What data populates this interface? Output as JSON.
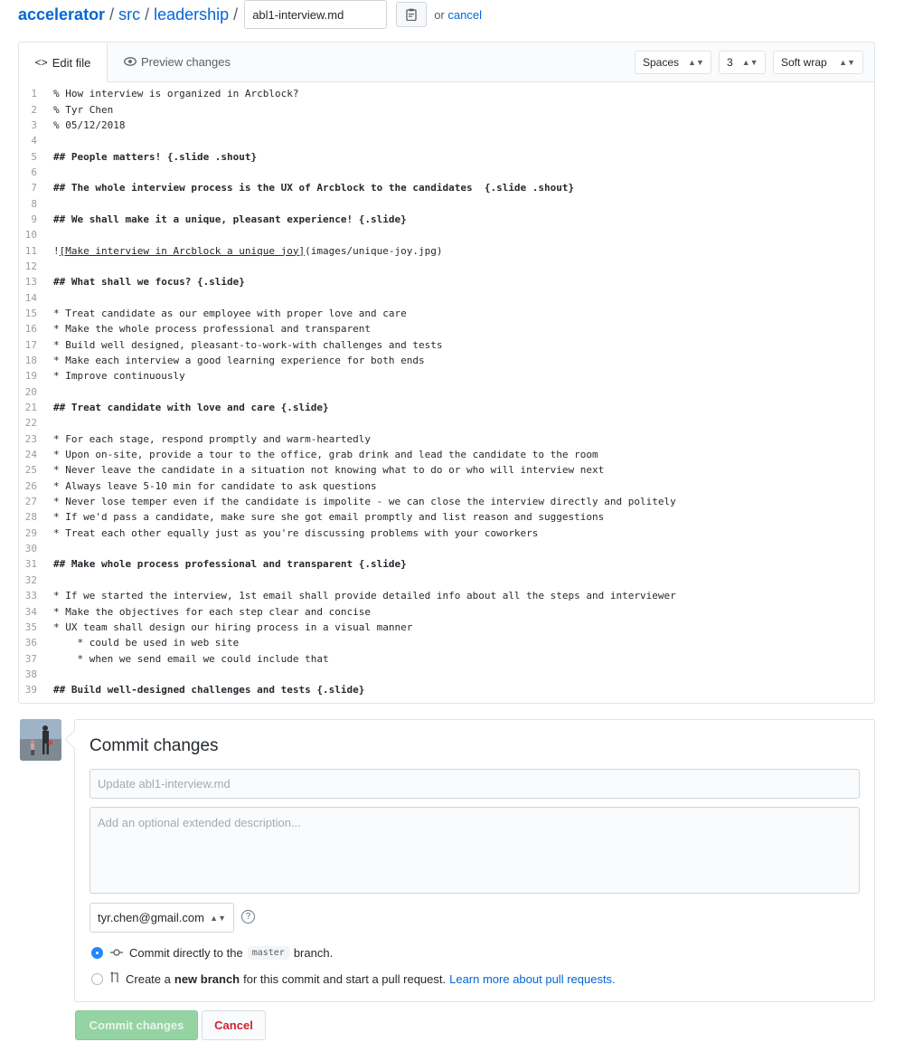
{
  "breadcrumb": {
    "repo": "accelerator",
    "path": [
      "src",
      "leadership"
    ],
    "separator": "/",
    "filename": "abl1-interview.md",
    "or_text": "or",
    "cancel_link": "cancel"
  },
  "editor": {
    "tabs": [
      {
        "label": "Edit file",
        "icon": "code-icon",
        "active": true
      },
      {
        "label": "Preview changes",
        "icon": "eye-icon",
        "active": false
      }
    ],
    "indent_mode": "Spaces",
    "indent_size": "3",
    "wrap_mode": "Soft wrap",
    "lines": [
      {
        "n": "1",
        "text": "% How interview is organized in Arcblock?",
        "heading": false
      },
      {
        "n": "2",
        "text": "% Tyr Chen",
        "heading": false
      },
      {
        "n": "3",
        "text": "% 05/12/2018",
        "heading": false
      },
      {
        "n": "4",
        "text": "",
        "heading": false
      },
      {
        "n": "5",
        "text": "## People matters! {.slide .shout}",
        "heading": true
      },
      {
        "n": "6",
        "text": "",
        "heading": false
      },
      {
        "n": "7",
        "text": "## The whole interview process is the UX of Arcblock to the candidates  {.slide .shout}",
        "heading": true
      },
      {
        "n": "8",
        "text": "",
        "heading": false
      },
      {
        "n": "9",
        "text": "## We shall make it a unique, pleasant experience! {.slide}",
        "heading": true
      },
      {
        "n": "10",
        "text": "",
        "heading": false
      },
      {
        "n": "11",
        "text": "![Make interview in Arcblock a unique joy](images/unique-joy.jpg)",
        "heading": false,
        "link_text": "[Make interview in Arcblock a unique joy]",
        "prefix": "!",
        "suffix": "(images/unique-joy.jpg)"
      },
      {
        "n": "12",
        "text": "",
        "heading": false
      },
      {
        "n": "13",
        "text": "## What shall we focus? {.slide}",
        "heading": true
      },
      {
        "n": "14",
        "text": "",
        "heading": false
      },
      {
        "n": "15",
        "text": "* Treat candidate as our employee with proper love and care",
        "heading": false
      },
      {
        "n": "16",
        "text": "* Make the whole process professional and transparent",
        "heading": false
      },
      {
        "n": "17",
        "text": "* Build well designed, pleasant-to-work-with challenges and tests",
        "heading": false
      },
      {
        "n": "18",
        "text": "* Make each interview a good learning experience for both ends",
        "heading": false
      },
      {
        "n": "19",
        "text": "* Improve continuously",
        "heading": false
      },
      {
        "n": "20",
        "text": "",
        "heading": false
      },
      {
        "n": "21",
        "text": "## Treat candidate with love and care {.slide}",
        "heading": true
      },
      {
        "n": "22",
        "text": "",
        "heading": false
      },
      {
        "n": "23",
        "text": "* For each stage, respond promptly and warm-heartedly",
        "heading": false
      },
      {
        "n": "24",
        "text": "* Upon on-site, provide a tour to the office, grab drink and lead the candidate to the room",
        "heading": false
      },
      {
        "n": "25",
        "text": "* Never leave the candidate in a situation not knowing what to do or who will interview next",
        "heading": false
      },
      {
        "n": "26",
        "text": "* Always leave 5-10 min for candidate to ask questions",
        "heading": false
      },
      {
        "n": "27",
        "text": "* Never lose temper even if the candidate is impolite - we can close the interview directly and politely",
        "heading": false
      },
      {
        "n": "28",
        "text": "* If we'd pass a candidate, make sure she got email promptly and list reason and suggestions",
        "heading": false
      },
      {
        "n": "29",
        "text": "* Treat each other equally just as you're discussing problems with your coworkers",
        "heading": false
      },
      {
        "n": "30",
        "text": "",
        "heading": false
      },
      {
        "n": "31",
        "text": "## Make whole process professional and transparent {.slide}",
        "heading": true
      },
      {
        "n": "32",
        "text": "",
        "heading": false
      },
      {
        "n": "33",
        "text": "* If we started the interview, 1st email shall provide detailed info about all the steps and interviewer",
        "heading": false
      },
      {
        "n": "34",
        "text": "* Make the objectives for each step clear and concise",
        "heading": false
      },
      {
        "n": "35",
        "text": "* UX team shall design our hiring process in a visual manner",
        "heading": false
      },
      {
        "n": "36",
        "text": "    * could be used in web site",
        "heading": false
      },
      {
        "n": "37",
        "text": "    * when we send email we could include that",
        "heading": false
      },
      {
        "n": "38",
        "text": "",
        "heading": false
      },
      {
        "n": "39",
        "text": "## Build well-designed challenges and tests {.slide}",
        "heading": true
      }
    ]
  },
  "commit": {
    "title": "Commit changes",
    "summary_placeholder": "Update abl1-interview.md",
    "description_placeholder": "Add an optional extended description...",
    "email": "tyr.chen@gmail.com",
    "help": "?",
    "option_direct": {
      "before": "Commit directly to the",
      "branch": "master",
      "after": "branch.",
      "checked": true
    },
    "option_new_branch": {
      "before": "Create a",
      "bold": "new branch",
      "after": "for this commit and start a pull request.",
      "link": "Learn more about pull requests.",
      "checked": false
    },
    "commit_button": "Commit changes",
    "cancel_button": "Cancel"
  },
  "colors": {
    "link": "#0366d6",
    "commit_button": "#94d3a2",
    "cancel_text": "#cb2431",
    "radio_selected": "#2188ff"
  }
}
